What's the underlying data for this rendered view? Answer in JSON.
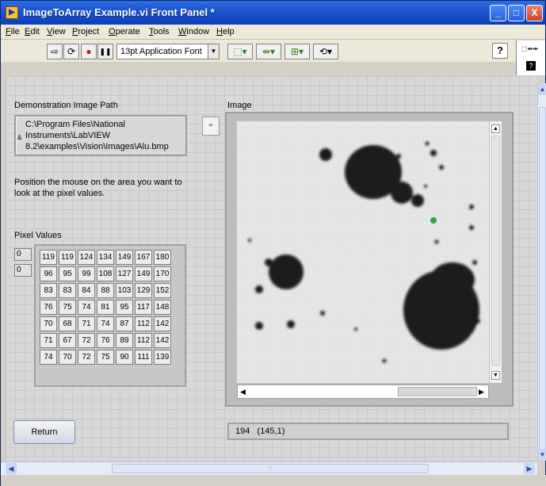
{
  "window": {
    "title": "ImageToArray Example.vi Front Panel *",
    "title_icon": "labview-vi-icon",
    "controls": {
      "minimize": "_",
      "maximize": "□",
      "close": "X"
    }
  },
  "menu": [
    "File",
    "Edit",
    "View",
    "Project",
    "Operate",
    "Tools",
    "Window",
    "Help"
  ],
  "toolbar": {
    "run_icon": "⇨",
    "run_continuous_icon": "⟳",
    "abort_icon": "●",
    "pause_icon": "❚❚",
    "font": "13pt Application Font",
    "align_icon": "⬚▾",
    "distribute_icon": "⇹▾",
    "resize_icon": "⊞▾",
    "reorder_icon": "⟲▾",
    "help_icon": "?",
    "connector_top": "⬚⇹⇹",
    "connector_bottom": "?"
  },
  "panel": {
    "image_path": {
      "label": "Demonstration Image Path",
      "value": "C:\\Program Files\\National Instruments\\LabVIEW 8.2\\examples\\Vision\\Images\\Alu.bmp",
      "browse_icon": "⌖"
    },
    "instructions": "Position the mouse on the area you want to look at the pixel values.",
    "pixel_values": {
      "label": "Pixel Values",
      "row_index": "0",
      "col_index": "0",
      "rows": [
        [
          "119",
          "119",
          "124",
          "134",
          "149",
          "167",
          "180"
        ],
        [
          "96",
          "95",
          "99",
          "108",
          "127",
          "149",
          "170"
        ],
        [
          "83",
          "83",
          "84",
          "88",
          "103",
          "129",
          "152"
        ],
        [
          "76",
          "75",
          "74",
          "81",
          "95",
          "117",
          "148"
        ],
        [
          "70",
          "68",
          "71",
          "74",
          "87",
          "112",
          "142"
        ],
        [
          "71",
          "67",
          "72",
          "76",
          "89",
          "112",
          "142"
        ],
        [
          "74",
          "70",
          "72",
          "75",
          "90",
          "111",
          "139"
        ]
      ]
    },
    "image": {
      "label": "Image",
      "status_value": "194",
      "status_coords": "(145,1)"
    },
    "return_button": "Return"
  },
  "colors": {
    "title_bar": "#1c52cf",
    "panel_bg": "#d8d8d8",
    "particle": "#1a1a1a",
    "marker": "#2ea84a"
  }
}
